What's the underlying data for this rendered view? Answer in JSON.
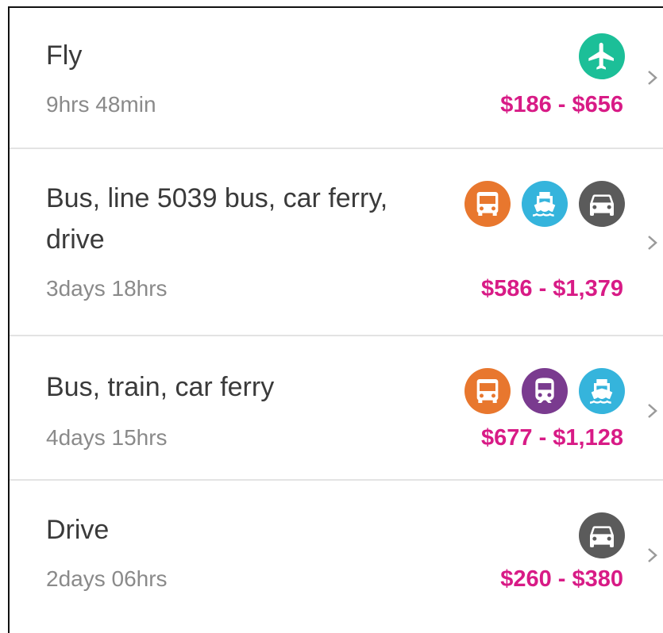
{
  "routes": [
    {
      "name": "Fly",
      "duration": "9hrs 48min",
      "price": "$186 - $656",
      "icons": [
        "airplane-icon"
      ]
    },
    {
      "name": "Bus, line 5039 bus, car ferry, drive",
      "duration": "3days 18hrs",
      "price": "$586 - $1,379",
      "icons": [
        "bus-icon",
        "ferry-icon",
        "car-icon"
      ]
    },
    {
      "name": "Bus, train, car ferry",
      "duration": "4days 15hrs",
      "price": "$677 - $1,128",
      "icons": [
        "bus-icon",
        "train-icon",
        "ferry-icon"
      ]
    },
    {
      "name": "Drive",
      "duration": "2days 06hrs",
      "price": "$260 - $380",
      "icons": [
        "car-icon"
      ]
    }
  ],
  "colors": {
    "price": "#d81b86",
    "fly": "#1cbf98",
    "bus": "#e8772e",
    "ferry": "#35b4dc",
    "car": "#5b5b5b",
    "train": "#7a3b8f"
  }
}
